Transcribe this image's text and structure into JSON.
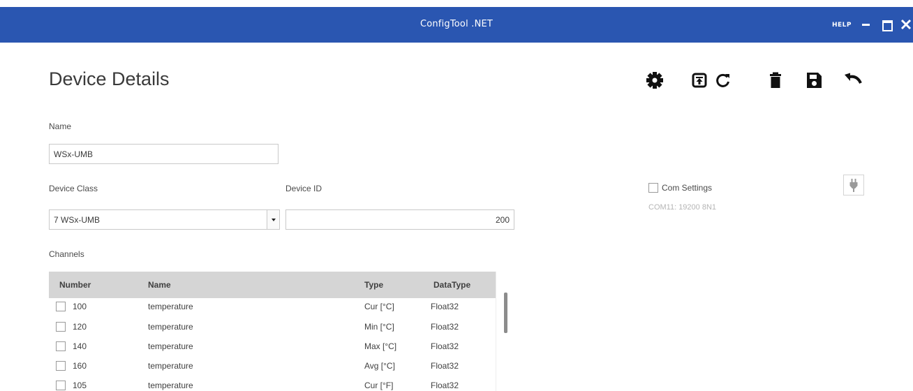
{
  "window": {
    "title": "ConfigTool .NET",
    "help_label": "HELP"
  },
  "page": {
    "title": "Device Details"
  },
  "toolbar": {
    "icons": [
      "gear-icon",
      "upload-icon",
      "refresh-icon",
      "trash-icon",
      "save-icon",
      "undo-icon"
    ]
  },
  "form": {
    "name_label": "Name",
    "name_value": "WSx-UMB",
    "device_class_label": "Device Class",
    "device_class_value": "7 WSx-UMB",
    "device_id_label": "Device ID",
    "device_id_value": "200",
    "channels_label": "Channels"
  },
  "com": {
    "label": "Com Settings",
    "checked": false,
    "status": "COM11: 19200 8N1",
    "icon": "plug-icon"
  },
  "channels": {
    "columns": {
      "number": "Number",
      "name": "Name",
      "type": "Type",
      "datatype": "DataType"
    },
    "rows": [
      {
        "number": "100",
        "name": "temperature",
        "type": "Cur [°C]",
        "datatype": "Float32",
        "checked": false
      },
      {
        "number": "120",
        "name": "temperature",
        "type": "Min [°C]",
        "datatype": "Float32",
        "checked": false
      },
      {
        "number": "140",
        "name": "temperature",
        "type": "Max [°C]",
        "datatype": "Float32",
        "checked": false
      },
      {
        "number": "160",
        "name": "temperature",
        "type": "Avg [°C]",
        "datatype": "Float32",
        "checked": false
      },
      {
        "number": "105",
        "name": "temperature",
        "type": "Cur [°F]",
        "datatype": "Float32",
        "checked": false
      }
    ]
  },
  "colors": {
    "titlebar": "#2a56b1",
    "table_header": "#d5d5d5"
  }
}
